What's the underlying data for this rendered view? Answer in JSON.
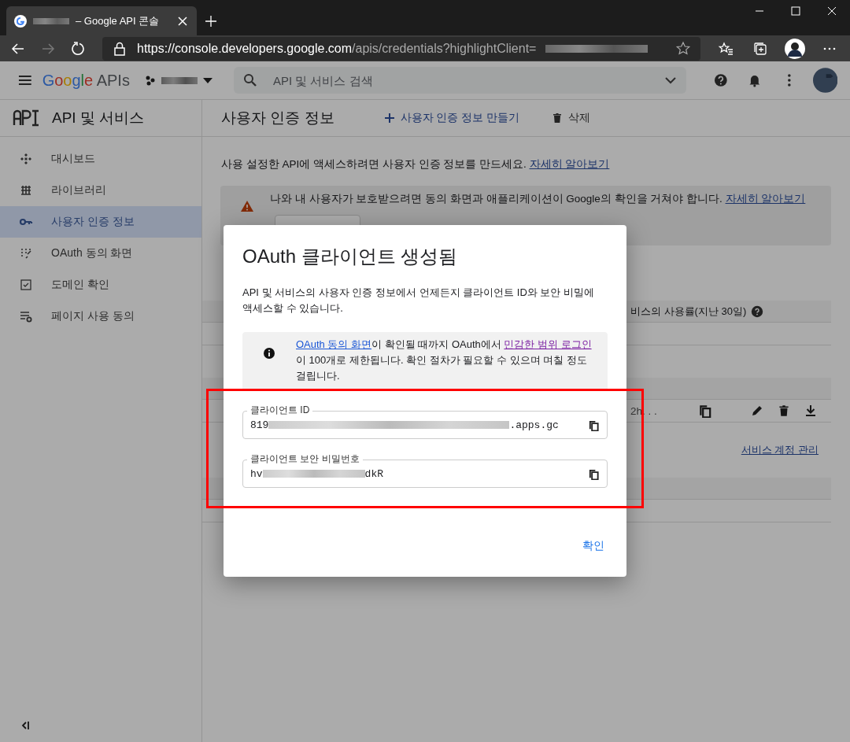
{
  "browser": {
    "tab_title": "– Google API 콘솔",
    "url_host": "https://console.developers.google.com",
    "url_path": "/apis/credentials?highlightClient="
  },
  "header": {
    "logo": "Google",
    "product": "APIs",
    "search": {
      "placeholder": "API 및 서비스 검색"
    }
  },
  "sidebar": {
    "title": "API 및 서비스",
    "items": [
      {
        "label": "대시보드",
        "kind": "dashboard",
        "selected": false
      },
      {
        "label": "라이브러리",
        "kind": "library",
        "selected": false
      },
      {
        "label": "사용자 인증 정보",
        "kind": "key",
        "selected": true
      },
      {
        "label": "OAuth 동의 화면",
        "kind": "consent",
        "selected": false
      },
      {
        "label": "도메인 확인",
        "kind": "domain",
        "selected": false
      },
      {
        "label": "페이지 사용 동의",
        "kind": "settings",
        "selected": false
      }
    ]
  },
  "content": {
    "title": "사용자 인증 정보",
    "actions": [
      {
        "label": "사용자 인증 정보 만들기",
        "kind": "create"
      },
      {
        "label": "삭제",
        "kind": "delete"
      }
    ],
    "intro": "사용 설정한 API에 액세스하려면 사용자 인증 정보를 만드세요.",
    "intro_link": "자세히 알아보기",
    "warning": {
      "text": "나와 내 사용자가 보호받으려면 동의 화면과 애플리케이션이 Google의 확인을 거쳐야 합니다.",
      "link": "자세히 알아보기"
    },
    "usage_header": "비스의 사용률(지난 30일)",
    "client_cell": "2h. . .",
    "service_link": "서비스 계정 관리"
  },
  "dialog": {
    "title": "OAuth 클라이언트 생성됨",
    "description": "API 및 서비스의 사용자 인증 정보에서 언제든지 클라이언트 ID와 보안 비밀에 액세스할 수 있습니다.",
    "notice": {
      "link1": "OAuth 동의 화면",
      "text1": "이 확인될 때까지 OAuth에서 ",
      "link2": "민감한 범위 로그인",
      "text2": "이 100개로 제한됩니다. 확인 절차가 필요할 수 있으며 며칠 정도 걸립니다."
    },
    "fields": [
      {
        "label": "클라이언트 ID",
        "value_start": "819",
        "value_end": ".apps.gc"
      },
      {
        "label": "클라이언트 보안 비밀번호",
        "value_start": "hv",
        "value_end": "dkR"
      }
    ],
    "confirm": "확인"
  }
}
